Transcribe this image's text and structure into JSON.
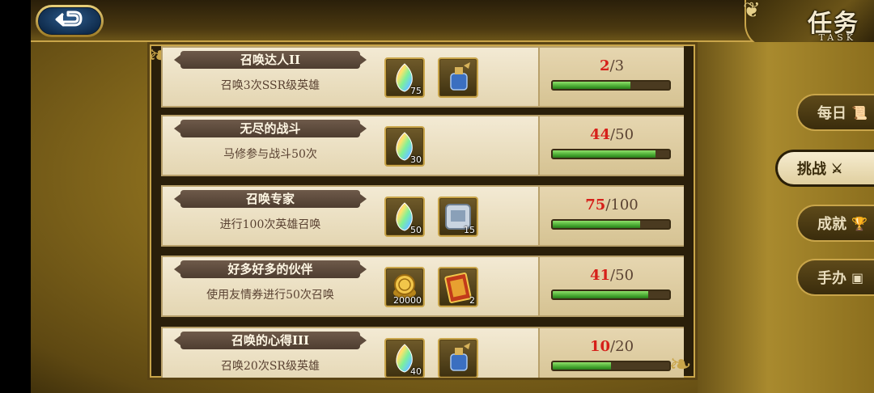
{
  "header": {
    "back_icon": "return-arrow-icon",
    "title": "任务",
    "subtitle": "TASK"
  },
  "tabs": [
    {
      "label": "每日",
      "icon": "scroll-icon",
      "active": false
    },
    {
      "label": "挑战",
      "icon": "crossed-swords-icon",
      "active": true
    },
    {
      "label": "成就",
      "icon": "trophy-icon",
      "active": false
    },
    {
      "label": "手办",
      "icon": "figure-box-icon",
      "active": false
    }
  ],
  "tasks": [
    {
      "name": "召唤达人II",
      "description": "召唤3次SSR级英雄",
      "rewards": [
        {
          "icon": "rainbow-crystal-icon",
          "count": "75"
        },
        {
          "icon": "blue-potion-icon",
          "count": ""
        }
      ],
      "progress_current": "2",
      "progress_total": "/3",
      "progress_fraction": 0.667
    },
    {
      "name": "无尽的战斗",
      "description": "马修参与战斗50次",
      "rewards": [
        {
          "icon": "rainbow-crystal-icon",
          "count": "30"
        }
      ],
      "progress_current": "44",
      "progress_total": "/50",
      "progress_fraction": 0.88
    },
    {
      "name": "召唤专家",
      "description": "进行100次英雄召唤",
      "rewards": [
        {
          "icon": "rainbow-crystal-icon",
          "count": "50"
        },
        {
          "icon": "silver-ticket-icon",
          "count": "15"
        }
      ],
      "progress_current": "75",
      "progress_total": "/100",
      "progress_fraction": 0.75
    },
    {
      "name": "好多好多的伙伴",
      "description": "使用友情券进行50次召唤",
      "rewards": [
        {
          "icon": "gold-coin-icon",
          "count": "20000"
        },
        {
          "icon": "red-card-icon",
          "count": "2"
        }
      ],
      "progress_current": "41",
      "progress_total": "/50",
      "progress_fraction": 0.82
    },
    {
      "name": "召唤的心得III",
      "description": "召唤20次SR级英雄",
      "rewards": [
        {
          "icon": "rainbow-crystal-icon",
          "count": "40"
        },
        {
          "icon": "blue-potion-icon",
          "count": ""
        }
      ],
      "progress_current": "10",
      "progress_total": "/20",
      "progress_fraction": 0.5
    }
  ]
}
